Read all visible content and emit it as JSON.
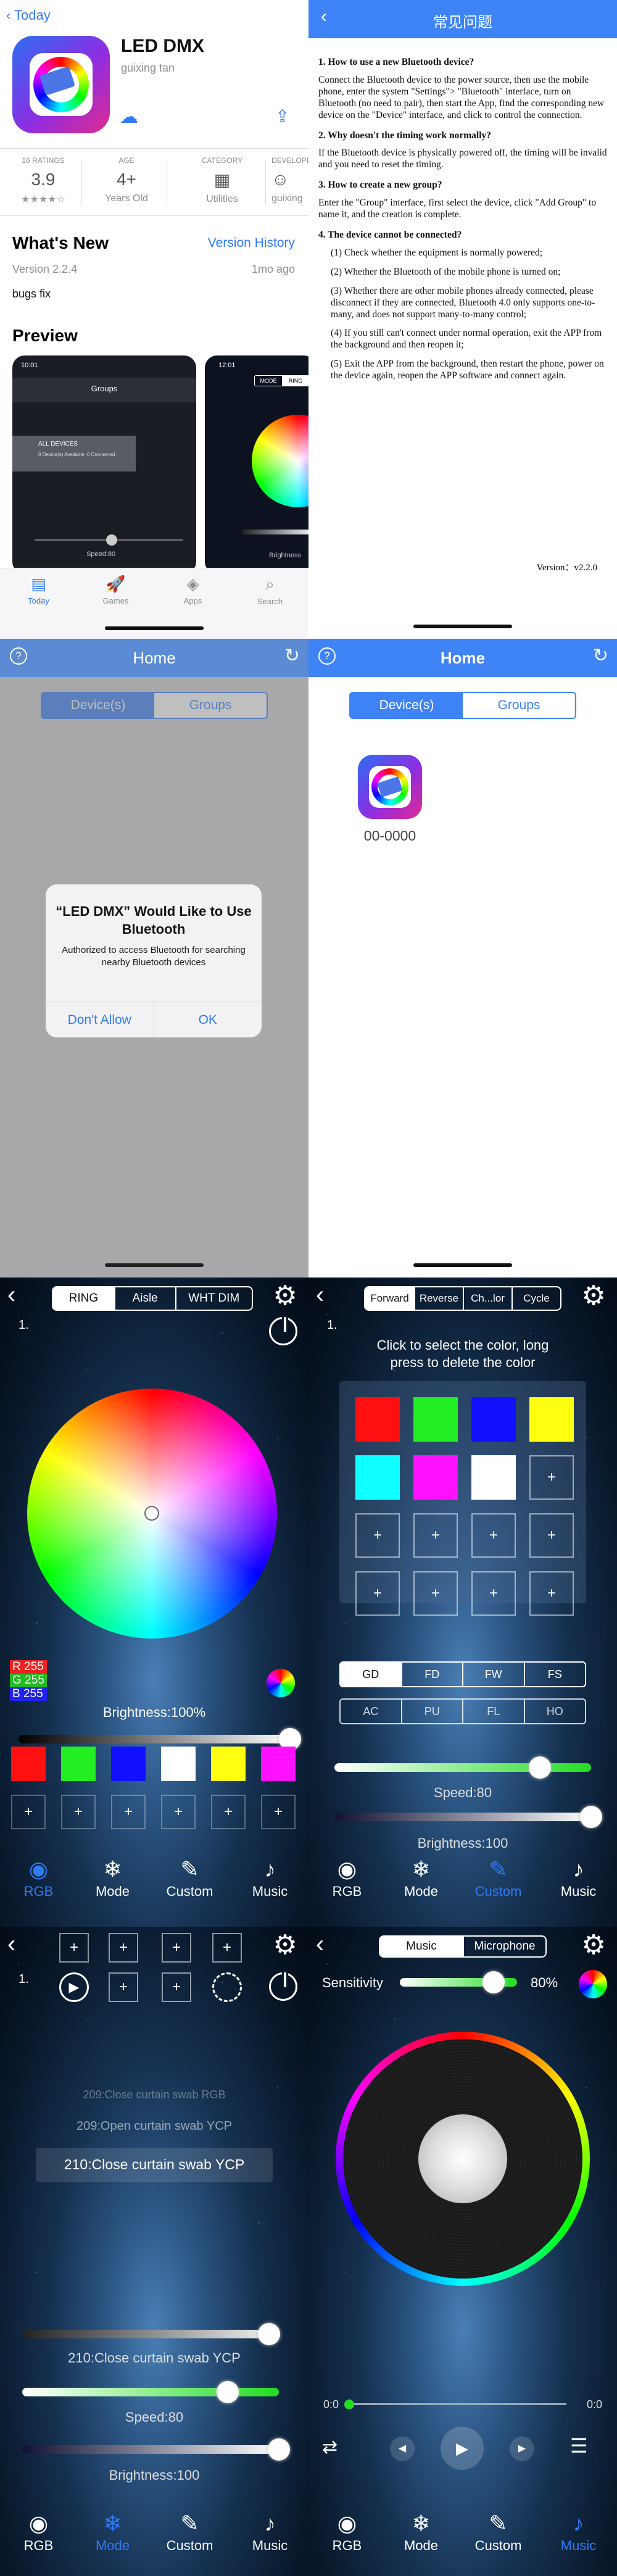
{
  "appstore": {
    "back": "Today",
    "app_name": "LED DMX",
    "developer": "guixing tan",
    "ratings_label": "16 RATINGS",
    "rating": "3.9",
    "stars": "★★★★☆",
    "age_label": "AGE",
    "age": "4+",
    "age_sub": "Years Old",
    "category_label": "CATEGORY",
    "category_sub": "Utilities",
    "developer_label": "DEVELOPER",
    "developer_sub": "guixing",
    "whats_new": "What's New",
    "version_history": "Version History",
    "version": "Version 2.2.4",
    "ago": "1mo ago",
    "notes": "bugs fix",
    "preview": "Preview",
    "shot1_time": "10:01",
    "shot1_title": "Groups",
    "shot1_all": "ALL DEVICES",
    "shot1_all_sub": "0 Device(s) Available, 0 Connected",
    "shot1_speed": "Speed:80",
    "shot2_time": "12:01",
    "shot2_tab1": "MODE",
    "shot2_tab2": "RING",
    "shot2_bright": "Brightness",
    "tabs": [
      {
        "icon": "▤",
        "label": "Today"
      },
      {
        "icon": "🚀",
        "label": "Games"
      },
      {
        "icon": "◈",
        "label": "Apps"
      },
      {
        "icon": "⌕",
        "label": "Search"
      }
    ]
  },
  "faq": {
    "title": "常见问题",
    "q1": "1. How to use a new Bluetooth device?",
    "a1": "Connect the Bluetooth device to the power source, then use the mobile phone, enter the system \"Settings\"> \"Bluetooth\" interface, turn on Bluetooth (no need to pair), then start the App, find the corresponding new device on the \"Device\" interface, and click to control the connection.",
    "q2": "2. Why doesn't the timing work normally?",
    "a2": "If the Bluetooth device is physically powered off, the timing will be invalid and you need to reset the timing.",
    "q3": "3. How to create a new group?",
    "a3": "Enter the \"Group\" interface, first select the device, click \"Add Group\" to name it, and the creation is complete.",
    "q4": "4. The device cannot be connected?",
    "a4_1": "(1) Check whether the equipment is normally powered;",
    "a4_2": "(2) Whether the Bluetooth of the mobile phone is turned on;",
    "a4_3": "(3) Whether there are other mobile phones already connected, please disconnect if they are connected, Bluetooth 4.0 only supports one-to-many, and does not support many-to-many control;",
    "a4_4": "(4) If you still can't connect under normal operation, exit the APP from the background and then reopen it;",
    "a4_5": "(5) Exit the APP from the background, then restart the phone, power on the device again, reopen the APP software and connect again.",
    "version": "Version：v2.2.0"
  },
  "home": {
    "title": "Home",
    "tab_devices": "Device(s)",
    "tab_groups": "Groups",
    "alert_title": "“LED DMX” Would Like to Use Bluetooth",
    "alert_msg": "Authorized to access Bluetooth for searching nearby Bluetooth devices",
    "alert_deny": "Don't Allow",
    "alert_ok": "OK",
    "device_name": "00-0000"
  },
  "rgb": {
    "tabs": [
      "RING",
      "Aisle",
      "WHT DIM"
    ],
    "num": "1.",
    "r": "R 255",
    "g": "G 255",
    "b": "B 255",
    "brightness": "Brightness:100%",
    "brightness_level": 1.0
  },
  "custom": {
    "tabs": [
      "Forward",
      "Reverse",
      "Ch...lor",
      "Cycle"
    ],
    "num": "1.",
    "hint": "Click to select the color, long press to delete the color",
    "modes_row1": [
      "GD",
      "FD",
      "FW",
      "FS"
    ],
    "modes_row2": [
      "AC",
      "PU",
      "FL",
      "HO"
    ],
    "speed": "Speed:80",
    "speed_level": 0.8,
    "brightness": "Brightness:100",
    "brightness_level": 1.0
  },
  "mode": {
    "num": "1.",
    "items": [
      "209:Close curtain swab RGB",
      "209:Open curtain swab YCP",
      "210:Close curtain swab YCP"
    ],
    "selected_label": "210:Close curtain swab YCP",
    "speed": "Speed:80",
    "speed_level": 0.8,
    "brightness": "Brightness:100",
    "brightness_level": 1.0
  },
  "music": {
    "tab_music": "Music",
    "tab_mic": "Microphone",
    "sensitivity_label": "Sensitivity",
    "sensitivity_value": "80%",
    "sensitivity_level": 0.8,
    "time_start": "0:0",
    "time_end": "0:0"
  },
  "bottom_tabs": [
    {
      "icon": "◉",
      "label": "RGB"
    },
    {
      "icon": "❄",
      "label": "Mode"
    },
    {
      "icon": "✎",
      "label": "Custom"
    },
    {
      "icon": "♪",
      "label": "Music"
    }
  ],
  "colors": {
    "accent": "#3f84f7",
    "palette": [
      "#ff1010",
      "#22ee22",
      "#1010ff",
      "#ffffff",
      "#ffff10",
      "#ff10ff"
    ],
    "custom_palette": [
      "#ff1010",
      "#22ee22",
      "#1010ff",
      "#ffff10",
      "#10ffff",
      "#ff10ff",
      "#ffffff"
    ]
  }
}
